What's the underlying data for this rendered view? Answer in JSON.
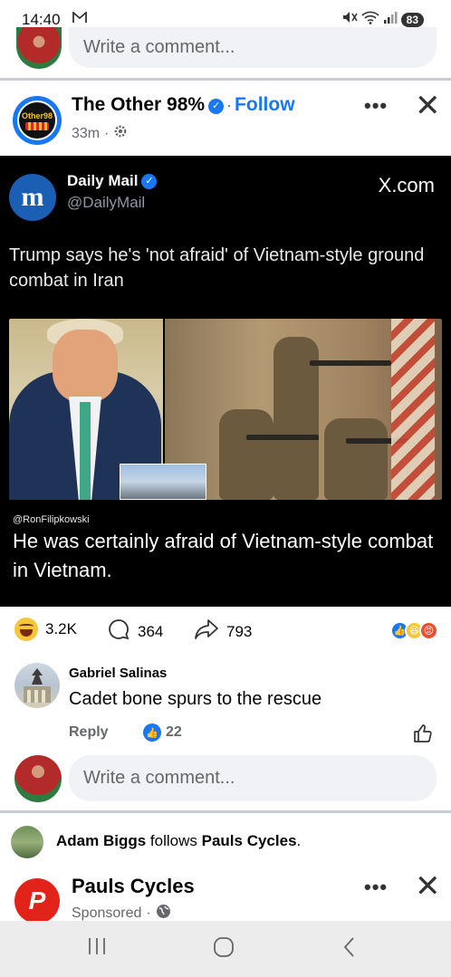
{
  "status_bar": {
    "time": "14:40",
    "battery": "83"
  },
  "top_comment_bar": {
    "placeholder": "Write a comment..."
  },
  "post": {
    "page_name": "The Other 98%",
    "logo_text": "Other98",
    "follow_label": "Follow",
    "time": "33m",
    "more_label": "•••",
    "close_label": "✕"
  },
  "embed": {
    "source_name": "Daily Mail",
    "source_handle": "@DailyMail",
    "source_logo": "m",
    "site": "X.com",
    "tweet_text": "Trump says he's 'not afraid' of Vietnam-style ground combat in Iran",
    "credit": "@RonFilipkowski",
    "caption": "He was certainly afraid of Vietnam-style combat in Vietnam."
  },
  "reactions": {
    "count": "3.2K",
    "comments": "364",
    "shares": "793"
  },
  "comment": {
    "author": "Gabriel Salinas",
    "text": "Cadet bone spurs to the rescue",
    "reply_label": "Reply",
    "likes": "22"
  },
  "bottom_comment_bar": {
    "placeholder": "Write a comment..."
  },
  "follow_notice": {
    "user": "Adam Biggs",
    "verb": "follows",
    "target": "Pauls Cycles",
    "end": "."
  },
  "sponsored": {
    "name": "Pauls Cycles",
    "label": "Sponsored",
    "logo": "P"
  },
  "colors": {
    "brand_blue": "#1877f2",
    "embed_bg": "#000000",
    "sponsor_red": "#e2231a"
  },
  "icons": [
    "mail-icon",
    "mute-icon",
    "wifi-icon",
    "signal-icon",
    "verified-icon",
    "gear-icon",
    "haha-icon",
    "comment-icon",
    "share-icon",
    "like-icon",
    "globe-icon"
  ]
}
